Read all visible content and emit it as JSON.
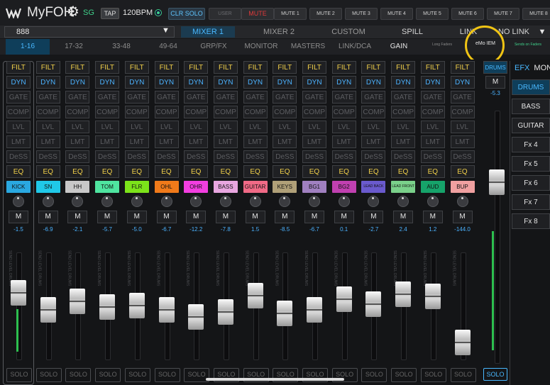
{
  "topbar": {
    "app_name": "MyFOH",
    "sg": "SG",
    "tap": "TAP",
    "bpm": "120BPM",
    "clr_solo": "CLR SOLO",
    "user": "USER",
    "mute": "MUTE",
    "mutes": [
      "MUTE 1",
      "MUTE 2",
      "MUTE 3",
      "MUTE 4",
      "MUTE 5",
      "MUTE 6",
      "MUTE 7",
      "MUTE 8"
    ]
  },
  "row2": {
    "session": "888",
    "tabs": [
      "MIXER 1",
      "MIXER 2",
      "CUSTOM",
      "SPILL",
      "LINK",
      "NO LINK"
    ]
  },
  "row3": {
    "banks": [
      "1-16",
      "17-32",
      "33-48",
      "49-64",
      "GRP/FX",
      "MONITOR",
      "MASTERS",
      "LINK/DCA",
      "GAIN"
    ],
    "long_faders": "Long Faders",
    "emo_iem": "eMo IEM",
    "sends_on_faders": "Sends on Faders"
  },
  "strip_buttons": {
    "filt": "FILT",
    "dyn": "DYN",
    "gate": "GATE",
    "comp": "COMP",
    "lvl": "LVL",
    "lmt": "LMT",
    "dess": "DeSS",
    "eq": "EQ",
    "m": "M",
    "solo": "SOLO",
    "send_label": "SEND LEVEL DRUMS"
  },
  "channels": [
    {
      "name": "KICK",
      "gain": "-1.5",
      "color": "#2aa8e0",
      "level": 0.66
    },
    {
      "name": "SN",
      "gain": "-6.9",
      "color": "#20c8e8",
      "level": 0.45
    },
    {
      "name": "HH",
      "gain": "-2.1",
      "color": "#c8c8c8",
      "level": 0.55
    },
    {
      "name": "TOM",
      "gain": "-5.7",
      "color": "#4fe4a0",
      "level": 0.48
    },
    {
      "name": "FLR",
      "gain": "-5.0",
      "color": "#7ce31a",
      "level": 0.5
    },
    {
      "name": "OHL",
      "gain": "-6.7",
      "color": "#f07a1a",
      "level": 0.45
    },
    {
      "name": "OHR",
      "gain": "-12.2",
      "color": "#f23ee0",
      "level": 0.36
    },
    {
      "name": "BASS",
      "gain": "-7.8",
      "color": "#e8a6e0",
      "level": 0.42
    },
    {
      "name": "GUITAR",
      "gain": "1.5",
      "color": "#f06a86",
      "level": 0.62
    },
    {
      "name": "KEYS",
      "gain": "-8.5",
      "color": "#b0a078",
      "level": 0.4
    },
    {
      "name": "BG1",
      "gain": "-6.7",
      "color": "#a080c0",
      "level": 0.45
    },
    {
      "name": "BG2",
      "gain": "0.1",
      "color": "#c040b0",
      "level": 0.58
    },
    {
      "name": "LEAD BACK",
      "gain": "-2.7",
      "color": "#6a5acd",
      "level": 0.52
    },
    {
      "name": "LEAD FRONT",
      "gain": "2.4",
      "color": "#7ad08a",
      "level": 0.64
    },
    {
      "name": "AUD",
      "gain": "1.2",
      "color": "#16a36a",
      "level": 0.61
    },
    {
      "name": "BUP",
      "gain": "-144.0",
      "color": "#f0a0a0",
      "level": 0.04
    }
  ],
  "master": {
    "name": "DRUMS",
    "m": "M",
    "gain": "-5.3",
    "solo": "SOLO",
    "level": 0.74
  },
  "right_panel": {
    "efx": "EFX",
    "mon": "MON",
    "items": [
      "DRUMS",
      "BASS",
      "GUITAR",
      "Fx 4",
      "Fx 5",
      "Fx 6",
      "Fx 7",
      "Fx 8"
    ]
  },
  "colors": {
    "accent_blue": "#49b8ff",
    "active_green": "#3fd08a",
    "highlight_yellow": "#f0c414"
  }
}
